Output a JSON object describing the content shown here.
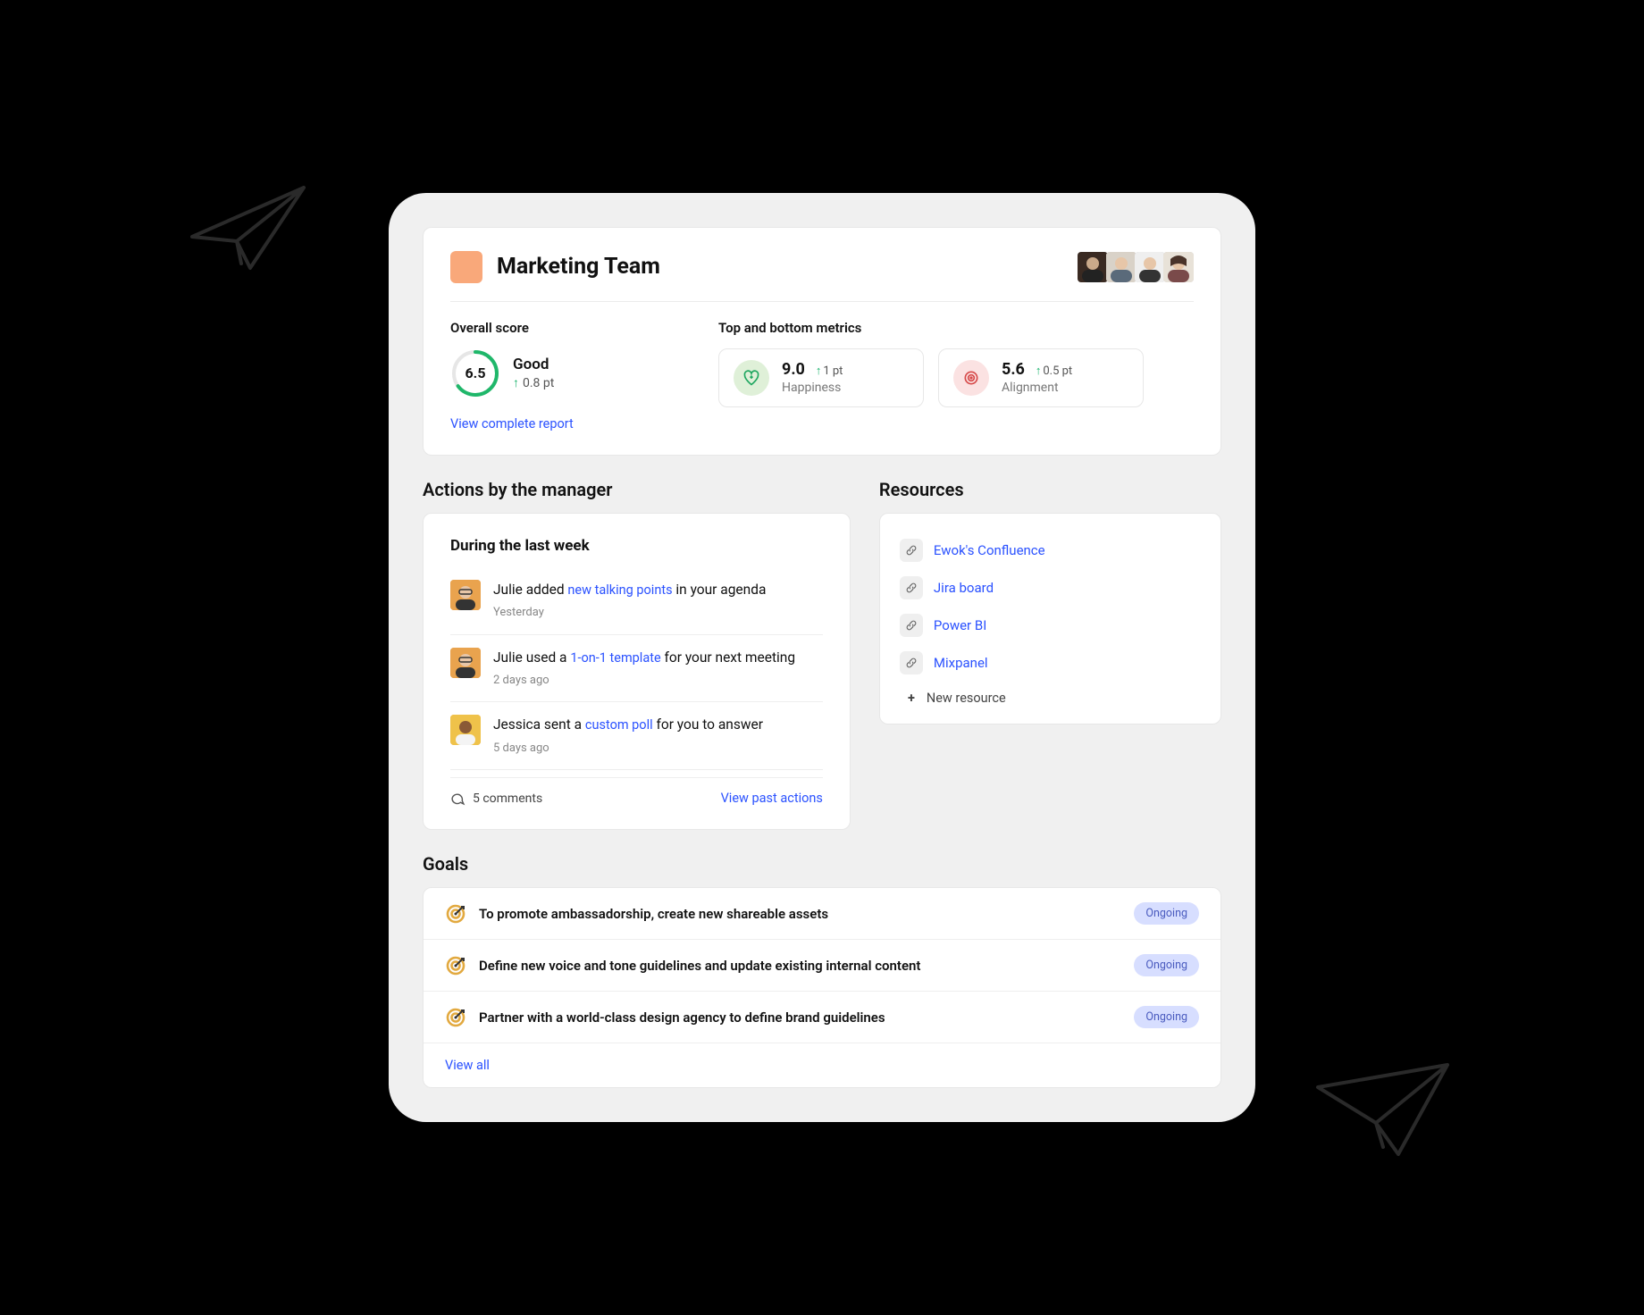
{
  "colors": {
    "accent_link": "#2b52ff",
    "team_swatch": "#f9a87a",
    "up_arrow": "#18b26b",
    "badge_bg": "#d7deff",
    "badge_text": "#4a5bbf"
  },
  "team": {
    "title": "Marketing Team",
    "avatars_count": 4
  },
  "overall": {
    "label": "Overall score",
    "value": "6.5",
    "rating": "Good",
    "delta": "0.8 pt",
    "delta_dir": "up",
    "report_link": "View complete report"
  },
  "metrics": {
    "label": "Top and bottom metrics",
    "items": [
      {
        "value": "9.0",
        "delta": "1 pt",
        "delta_dir": "up",
        "caption": "Happiness",
        "icon": "heart-plus-icon",
        "tone": "green"
      },
      {
        "value": "5.6",
        "delta": "0.5 pt",
        "delta_dir": "up",
        "caption": "Alignment",
        "icon": "target-icon",
        "tone": "red"
      }
    ]
  },
  "actions": {
    "title": "Actions by the manager",
    "range": "During the last week",
    "items": [
      {
        "who": "Julie",
        "pre": "Julie added ",
        "link": "new talking points",
        "post": " in your agenda",
        "time": "Yesterday"
      },
      {
        "who": "Julie",
        "pre": "Julie used a ",
        "link": "1-on-1 template",
        "post": " for your next meeting",
        "time": "2 days ago"
      },
      {
        "who": "Jessica",
        "pre": "Jessica sent a ",
        "link": "custom poll",
        "post": " for you to answer",
        "time": "5 days ago"
      }
    ],
    "comments_label": "5 comments",
    "past_link": "View past actions"
  },
  "resources": {
    "title": "Resources",
    "items": [
      {
        "label": "Ewok's Confluence"
      },
      {
        "label": "Jira board"
      },
      {
        "label": "Power BI"
      },
      {
        "label": "Mixpanel"
      }
    ],
    "new_label": "New resource"
  },
  "goals": {
    "title": "Goals",
    "items": [
      {
        "text": "To promote ambassadorship, create new shareable assets",
        "status": "Ongoing"
      },
      {
        "text": "Define new voice and tone guidelines and update existing internal content",
        "status": "Ongoing"
      },
      {
        "text": "Partner with a world-class design agency to define brand guidelines",
        "status": "Ongoing"
      }
    ],
    "view_all": "View all"
  }
}
